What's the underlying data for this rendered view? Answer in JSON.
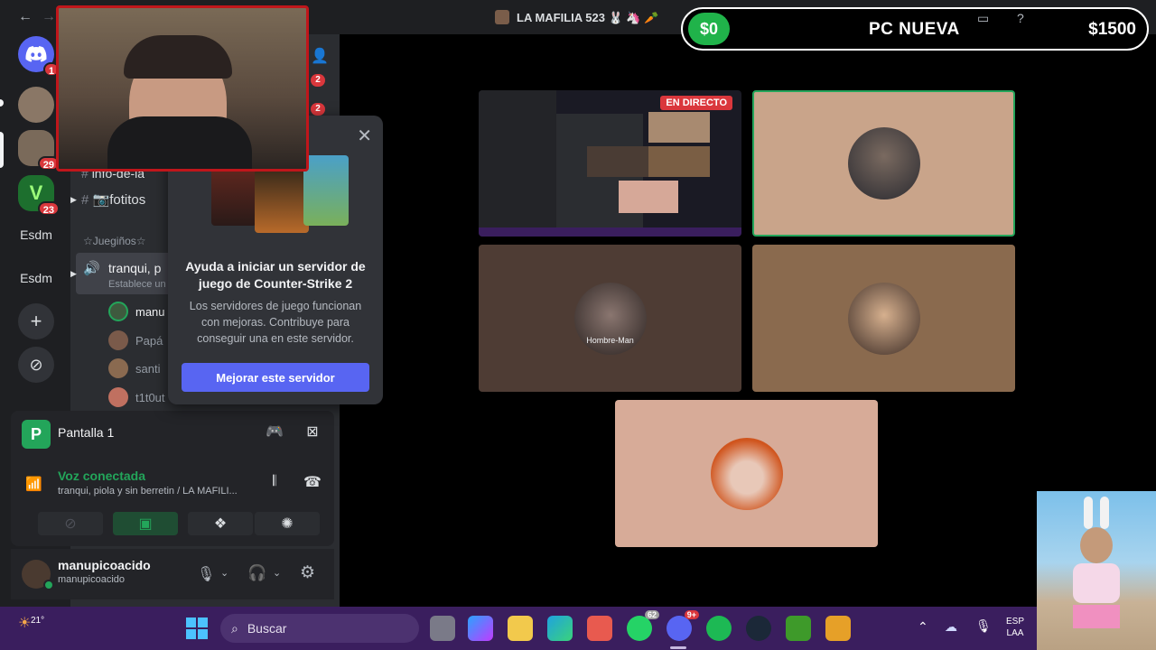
{
  "titlebar": {
    "back": "←",
    "forward": "→",
    "title": "LA MAFILIA 523 🐰 🦄 🥕",
    "icons": [
      "inbox-icon",
      "help-icon"
    ]
  },
  "server_rail": {
    "discord_badge": "1",
    "badges": [
      "29",
      "23"
    ],
    "text_servers": [
      "Esdm",
      "Esdm"
    ],
    "add": "+",
    "discover": "⊘"
  },
  "channels": {
    "member_counts": [
      "2",
      "2"
    ],
    "info_channel": "info-de-la",
    "fotitos": "📷fotitos",
    "category": "☆Juegiños☆",
    "voice_channel": "tranqui, p",
    "voice_status": "Establece un",
    "members": [
      "manu",
      "Papá",
      "santi",
      "t1t0ut"
    ]
  },
  "popup": {
    "close": "✕",
    "title": "Ayuda a iniciar un servidor de juego de Counter-Strike 2",
    "body": "Los servidores de juego funcionan con mejoras. Contribuye para conseguir una en este servidor.",
    "button": "Mejorar este servidor"
  },
  "voice_panel": {
    "stream_name": "Pantalla 1",
    "stream_icon_letter": "P",
    "status": "Voz conectada",
    "channel_path": "tranqui, piola y sin berretin / LA MAFILI..."
  },
  "user_panel": {
    "display_name": "manupicoacido",
    "username": "manupicoacido"
  },
  "money": {
    "current": "$0",
    "goal_label": "PC NUEVA",
    "goal": "$1500",
    "progress": 0
  },
  "video": {
    "live_badge": "EN DIRECTO",
    "tile_label": "Hombre-Man"
  },
  "taskbar": {
    "weather": "21°",
    "search_placeholder": "Buscar",
    "whatsapp_badge": "62",
    "discord_badge": "9+",
    "lang_1": "ESP",
    "lang_2": "LAA"
  },
  "colors": {
    "accent": "#5865f2",
    "voice_green": "#23a55a",
    "live_red": "#da373c",
    "money_green": "#20b34a",
    "taskbar": "#3a1e5e"
  }
}
